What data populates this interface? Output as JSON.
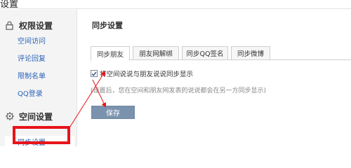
{
  "window": {
    "title": "设置"
  },
  "sidebar": {
    "sections": [
      {
        "title": "权限设置",
        "icon": "lock-icon",
        "items": [
          "空间访问",
          "评论回复",
          "限制名单",
          "QQ登录"
        ]
      },
      {
        "title": "空间设置",
        "icon": "gear-icon",
        "items": [
          "同步设置"
        ]
      }
    ],
    "active_item": "同步设置"
  },
  "main": {
    "title": "同步设置",
    "tabs": [
      {
        "label": "同步朋友",
        "active": true
      },
      {
        "label": "朋友网解绑",
        "active": false
      },
      {
        "label": "同步QQ签名",
        "active": false
      },
      {
        "label": "同步微博",
        "active": false
      }
    ],
    "option": {
      "label": "将空间说说与朋友说说同步显示",
      "checked": true
    },
    "hint": "(设置后，您在空间和朋友网发表的说说都会在另一方同步显示)",
    "save_label": "保存"
  },
  "colors": {
    "annotation": "#e8141a",
    "link": "#2a62b8",
    "button": "#7b92ae"
  }
}
